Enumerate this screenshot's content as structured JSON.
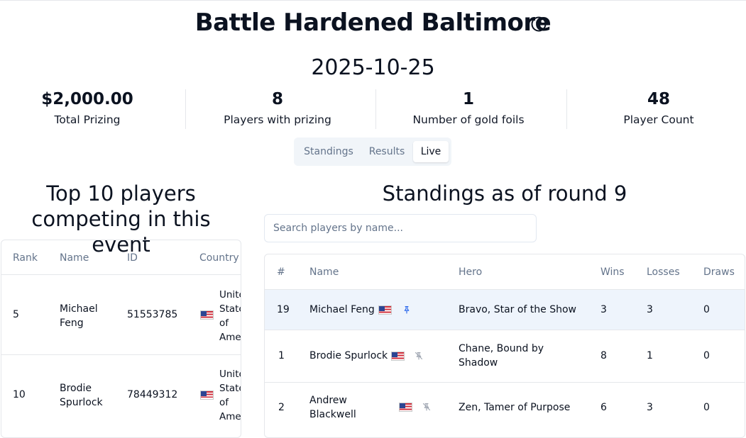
{
  "event": {
    "title": "Battle Hardened Baltimore",
    "date": "2025-10-25"
  },
  "stats": [
    {
      "value": "$2,000.00",
      "label": "Total Prizing"
    },
    {
      "value": "8",
      "label": "Players with prizing"
    },
    {
      "value": "1",
      "label": "Number of gold foils"
    },
    {
      "value": "48",
      "label": "Player Count"
    }
  ],
  "tabs": [
    {
      "label": "Standings",
      "active": false
    },
    {
      "label": "Results",
      "active": false
    },
    {
      "label": "Live",
      "active": true
    }
  ],
  "top_players": {
    "title_line1": "Top 10 players",
    "title_line2": "competing in this event",
    "columns": [
      "Rank",
      "Name",
      "ID",
      "Country"
    ],
    "rows": [
      {
        "rank": "5",
        "name_line1": "Michael",
        "name_line2": "Feng",
        "id": "51553785",
        "country_lines": [
          "Unite",
          "State",
          "of",
          "Ame"
        ]
      },
      {
        "rank": "10",
        "name_line1": "Brodie",
        "name_line2": "Spurlock",
        "id": "78449312",
        "country_lines": [
          "Unite",
          "State",
          "of",
          "Ame"
        ]
      }
    ]
  },
  "standings": {
    "title": "Standings as of round 9",
    "search_placeholder": "Search players by name...",
    "columns": [
      "#",
      "Name",
      "Hero",
      "Wins",
      "Losses",
      "Draws"
    ],
    "rows": [
      {
        "rank": "19",
        "name_line1": "Michael Feng",
        "name_line2": "",
        "hero_line1": "Bravo, Star of the Show",
        "hero_line2": "",
        "wins": "3",
        "losses": "3",
        "draws": "0",
        "pinned": true,
        "highlighted": true
      },
      {
        "rank": "1",
        "name_line1": "Brodie Spurlock",
        "name_line2": "",
        "hero_line1": "Chane, Bound by",
        "hero_line2": "Shadow",
        "wins": "8",
        "losses": "1",
        "draws": "0",
        "pinned": false,
        "highlighted": false
      },
      {
        "rank": "2",
        "name_line1": "Andrew",
        "name_line2": "Blackwell",
        "hero_line1": "Zen, Tamer of Purpose",
        "hero_line2": "",
        "wins": "6",
        "losses": "3",
        "draws": "0",
        "pinned": false,
        "highlighted": false
      }
    ]
  },
  "colors": {
    "highlight_row": "#eef4fc",
    "pin_active": "#2563eb",
    "pin_inactive": "#9ca3af"
  },
  "icons": {
    "help": "question-circle-icon",
    "flag": "us-flag-icon",
    "pin": "pin-icon",
    "unpin": "pin-off-icon"
  }
}
